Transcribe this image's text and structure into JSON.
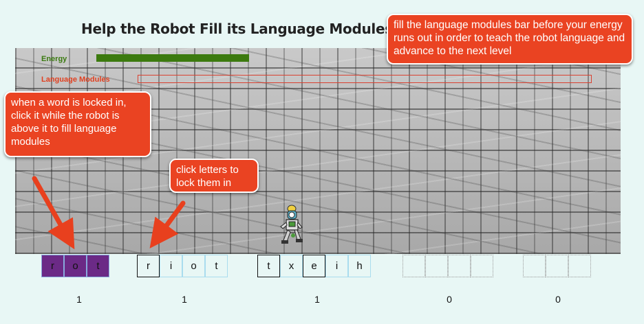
{
  "title": "Help the Robot Fill its Language Modules!",
  "hud": {
    "energy_label": "Energy",
    "energy_level": 0.27,
    "language_modules_label": "Language Modules",
    "language_modules_level": 0.0
  },
  "callouts": {
    "goal": "fill the language modules bar before your energy runs out in order to teach the robot language and advance to the next level",
    "word_click": "when a word is locked in, click it while the robot is above it to fill language modules",
    "letter_click": "click letters to lock them in"
  },
  "words": [
    {
      "letters": [
        "r",
        "o",
        "t"
      ],
      "states": [
        "used",
        "used",
        "used"
      ],
      "score": "1"
    },
    {
      "letters": [
        "r",
        "i",
        "o",
        "t"
      ],
      "states": [
        "locked",
        "open",
        "open",
        "open"
      ],
      "score": "1"
    },
    {
      "letters": [
        "t",
        "x",
        "e",
        "i",
        "h"
      ],
      "states": [
        "locked",
        "open",
        "locked",
        "open",
        "open"
      ],
      "score": "1"
    },
    {
      "letters": [
        "",
        "",
        "",
        ""
      ],
      "states": [
        "empty",
        "empty",
        "empty",
        "empty"
      ],
      "score": "0"
    },
    {
      "letters": [
        "",
        "",
        ""
      ],
      "states": [
        "empty",
        "empty",
        "empty"
      ],
      "score": "0"
    }
  ],
  "colors": {
    "energy": "#3c7a0f",
    "callout": "#ea4322",
    "used_tile": "#6b2a86"
  }
}
